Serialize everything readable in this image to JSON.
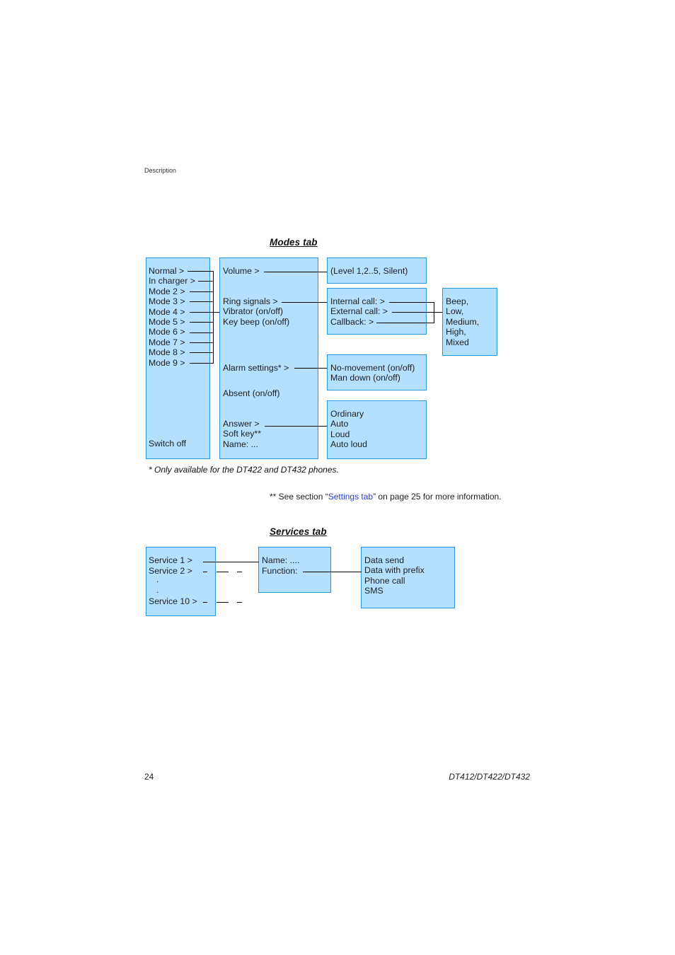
{
  "header": {
    "section": "Description"
  },
  "modes_tab": {
    "title": "Modes tab",
    "modes_list": [
      "Normal >",
      "In charger >",
      "Mode 2 >",
      "Mode 3 >",
      "Mode 4 >",
      "Mode 5 >",
      "Mode 6 >",
      "Mode 7 >",
      "Mode 8 >",
      "Mode 9 >"
    ],
    "switch_off": "Switch off",
    "settings": {
      "volume": "Volume >",
      "ring_signals": "Ring signals >",
      "vibrator": "Vibrator (on/off)",
      "key_beep": "Key beep (on/off)",
      "alarm_settings": "Alarm settings* >",
      "absent": "Absent (on/off)",
      "answer": "Answer >",
      "soft_key": "Soft key**",
      "name": "Name: ..."
    },
    "volume_options": "(Level 1,2..5, Silent)",
    "ring_signal_types": [
      "Internal call: >",
      "External call: >",
      "Callback: >"
    ],
    "ring_levels": [
      "Beep,",
      "Low,",
      "Medium,",
      "High,",
      "Mixed"
    ],
    "alarm_options": [
      "No-movement (on/off)",
      "Man down (on/off)"
    ],
    "answer_options": [
      "Ordinary",
      "Auto",
      "Loud",
      "Auto loud"
    ]
  },
  "footnotes": {
    "note1": "* Only available for the DT422 and DT432 phones.",
    "note2_prefix": "** See section “",
    "note2_link": "Settings tab",
    "note2_suffix": "” on page 25 for more information."
  },
  "services_tab": {
    "title": "Services tab",
    "services_list": [
      "Service 1 >",
      "Service 2 >",
      ".",
      ".",
      "Service 10 >"
    ],
    "service_fields": [
      "Name: ....",
      "Function:"
    ],
    "functions": [
      "Data send",
      "Data with prefix",
      "Phone call",
      "SMS"
    ]
  },
  "footer": {
    "page_number": "24",
    "model": "DT412/DT422/DT432"
  },
  "colors": {
    "box_fill": "#b3e0ff",
    "box_border": "#2b95e0",
    "link": "#2a3bdc"
  }
}
